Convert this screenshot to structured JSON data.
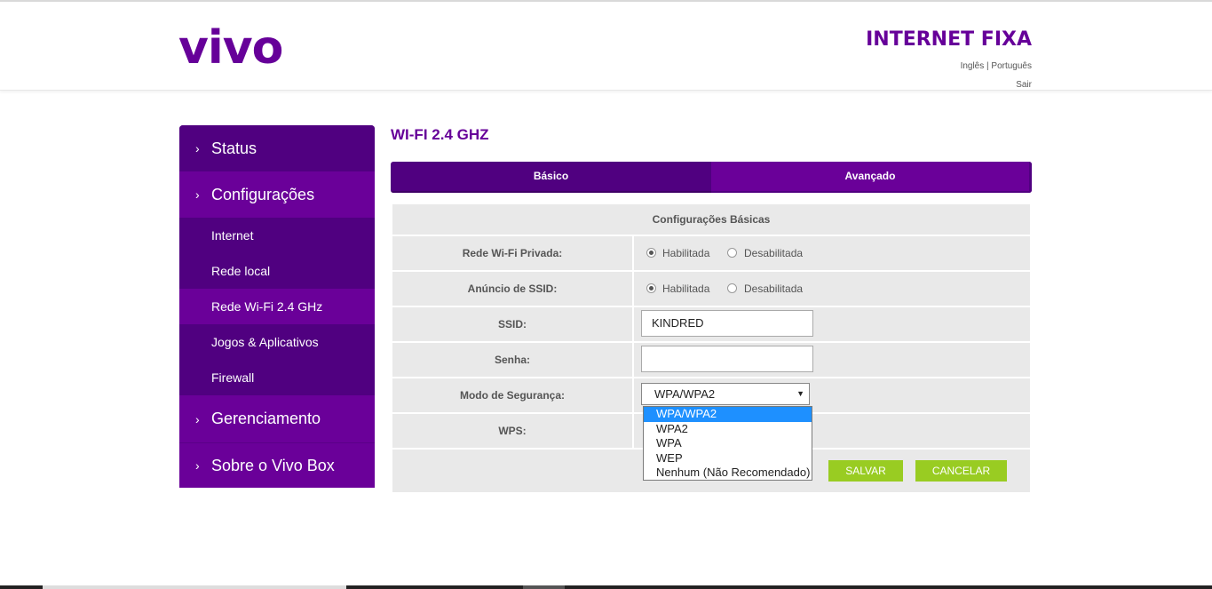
{
  "header": {
    "logo": "vivo",
    "title": "INTERNET FIXA",
    "lang_en": "Inglês",
    "lang_sep": " | ",
    "lang_pt": "Português",
    "logout": "Sair"
  },
  "sidebar": {
    "status": "Status",
    "config": "Configurações",
    "sub": [
      "Internet",
      "Rede local",
      "Rede Wi-Fi 2.4 GHz",
      "Jogos & Aplicativos",
      "Firewall"
    ],
    "gerenc": "Gerenciamento",
    "sobre": "Sobre o Vivo Box"
  },
  "page": {
    "title": "WI-FI 2.4 GHZ",
    "tab_basic": "Básico",
    "tab_advanced": "Avançado",
    "section": "Configurações Básicas"
  },
  "form": {
    "rede_label": "Rede Wi-Fi Privada:",
    "ssid_ad_label": "Anúncio de SSID:",
    "enabled": "Habilitada",
    "disabled": "Desabilitada",
    "ssid_label": "SSID:",
    "ssid_value": "KINDRED",
    "senha_label": "Senha:",
    "senha_value": "",
    "modo_label": "Modo de Segurança:",
    "modo_value": "WPA/WPA2",
    "wps_label": "WPS:",
    "save": "SALVAR",
    "cancel": "CANCELAR"
  },
  "dropdown": {
    "options": [
      "WPA/WPA2",
      "WPA2",
      "WPA",
      "WEP",
      "Nenhum (Não Recomendado)"
    ]
  },
  "colors": {
    "brand": "#660099",
    "accent": "#99cc22"
  }
}
